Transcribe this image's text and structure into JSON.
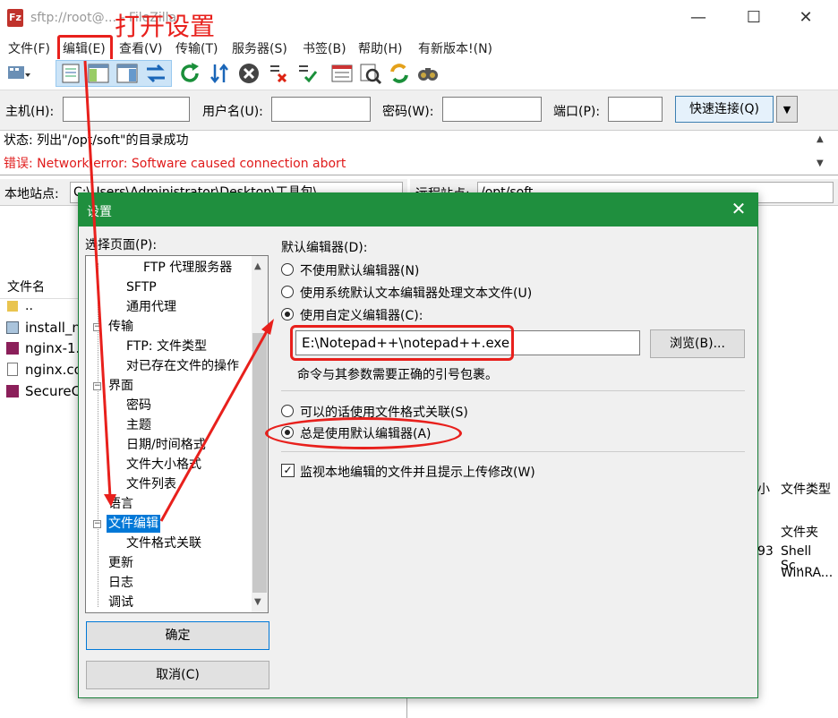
{
  "window": {
    "title": "sftp://root@... - FileZilla",
    "app_icon": "Fz",
    "minimize_icon": "—",
    "maximize_icon": "☐",
    "close_icon": "✕"
  },
  "annotation": {
    "text": "打开设置"
  },
  "menu": [
    {
      "label": "文件(F)"
    },
    {
      "label": "编辑(E)"
    },
    {
      "label": "查看(V)"
    },
    {
      "label": "传输(T)"
    },
    {
      "label": "服务器(S)"
    },
    {
      "label": "书签(B)"
    },
    {
      "label": "帮助(H)"
    },
    {
      "label": "有新版本!(N)"
    }
  ],
  "toolbar_icons": [
    "site-manager-icon",
    "toggle-log-icon",
    "toggle-local-tree-icon",
    "toggle-remote-tree-icon",
    "toggle-queue-icon",
    "refresh-icon",
    "process-queue-icon",
    "cancel-icon",
    "disconnect-icon",
    "reconnect-icon",
    "dir-listing-filter-icon",
    "toggle-sync-browse-icon",
    "directory-compare-icon",
    "search-icon"
  ],
  "quickconnect": {
    "host_label": "主机(H):",
    "user_label": "用户名(U):",
    "pass_label": "密码(W):",
    "port_label": "端口(P):",
    "button": "快速连接(Q)",
    "dropdown": "▼"
  },
  "log": {
    "status_line": "状态: 列出\"/opt/soft\"的目录成功",
    "error_line": "错误: Network error: Software caused connection abort",
    "scroll_up": "▲",
    "scroll_down": "▼"
  },
  "local_pane": {
    "site_label": "本地站点:",
    "site_path": "C:\\Users\\Administrator\\Desktop\\工具包\\",
    "col_filename": "文件名",
    "files": [
      "..",
      "install_n",
      "nginx-1.",
      "nginx.co",
      "SecureC"
    ]
  },
  "remote_pane": {
    "site_label": "远程站点:",
    "site_path": "/opt/soft",
    "col_size": "小",
    "col_type": "文件类型",
    "rows": [
      {
        "size": "",
        "type": "文件夹"
      },
      {
        "size": "93",
        "type": "Shell Sc.."
      },
      {
        "size": "",
        "type": "WinRA..."
      }
    ]
  },
  "dialog": {
    "title": "设置",
    "close": "✕",
    "page_label": "选择页面(P):",
    "tree": [
      {
        "label": "FTP 代理服务器",
        "level": 2
      },
      {
        "label": "SFTP",
        "level": 1
      },
      {
        "label": "通用代理",
        "level": 1
      },
      {
        "label": "传输",
        "level": 0,
        "box": "−"
      },
      {
        "label": "FTP: 文件类型",
        "level": 1
      },
      {
        "label": "对已存在文件的操作",
        "level": 1
      },
      {
        "label": "界面",
        "level": 0,
        "box": "−"
      },
      {
        "label": "密码",
        "level": 1
      },
      {
        "label": "主题",
        "level": 1
      },
      {
        "label": "日期/时间格式",
        "level": 1
      },
      {
        "label": "文件大小格式",
        "level": 1
      },
      {
        "label": "文件列表",
        "level": 1
      },
      {
        "label": "语言",
        "level": 0
      },
      {
        "label": "文件编辑",
        "level": 0,
        "box": "−",
        "selected": true
      },
      {
        "label": "文件格式关联",
        "level": 1
      },
      {
        "label": "更新",
        "level": 0
      },
      {
        "label": "日志",
        "level": 0
      },
      {
        "label": "调试",
        "level": 0
      }
    ],
    "ok": "确定",
    "cancel": "取消(C)",
    "group_title": "默认编辑器(D):",
    "options": [
      {
        "label": "不使用默认编辑器(N)",
        "checked": false
      },
      {
        "label": "使用系统默认文本编辑器处理文本文件(U)",
        "checked": false
      },
      {
        "label": "使用自定义编辑器(C):",
        "checked": true
      }
    ],
    "editor_path": "E:\\Notepad++\\notepad++.exe",
    "browse": "浏览(B)...",
    "hint": "命令与其参数需要正确的引号包裹。",
    "assoc_options": [
      {
        "label": "可以的话使用文件格式关联(S)",
        "checked": false
      },
      {
        "label": "总是使用默认编辑器(A)",
        "checked": true
      }
    ],
    "watch_label": "监视本地编辑的文件并且提示上传修改(W)",
    "watch_checked": "✓"
  }
}
